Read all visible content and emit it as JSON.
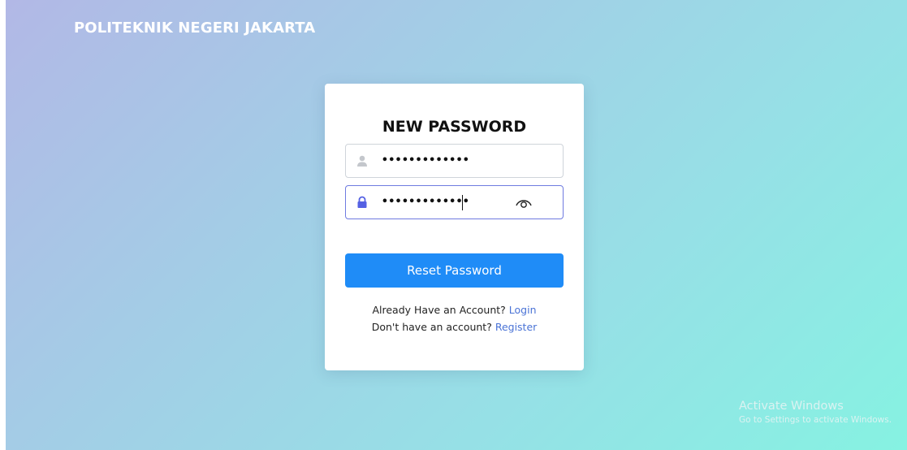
{
  "brand": {
    "name": "POLITEKNIK NEGERI JAKARTA"
  },
  "card": {
    "title": "NEW PASSWORD",
    "field_1": {
      "icon": "user-icon",
      "value": "•••••••••••••"
    },
    "field_2": {
      "icon": "lock-icon",
      "value": "•••••••••••••",
      "toggle_icon": "eye-icon"
    },
    "reset_button_label": "Reset Password",
    "login_prompt": "Already Have an Account? ",
    "login_link": "Login",
    "register_prompt": "Don't have an account? ",
    "register_link": "Register"
  },
  "watermark": {
    "title": "Activate Windows",
    "subtitle": "Go to Settings to activate Windows."
  },
  "colors": {
    "accent": "#1f8cf7",
    "link": "#4a73d6",
    "lock_icon": "#5561e3"
  }
}
